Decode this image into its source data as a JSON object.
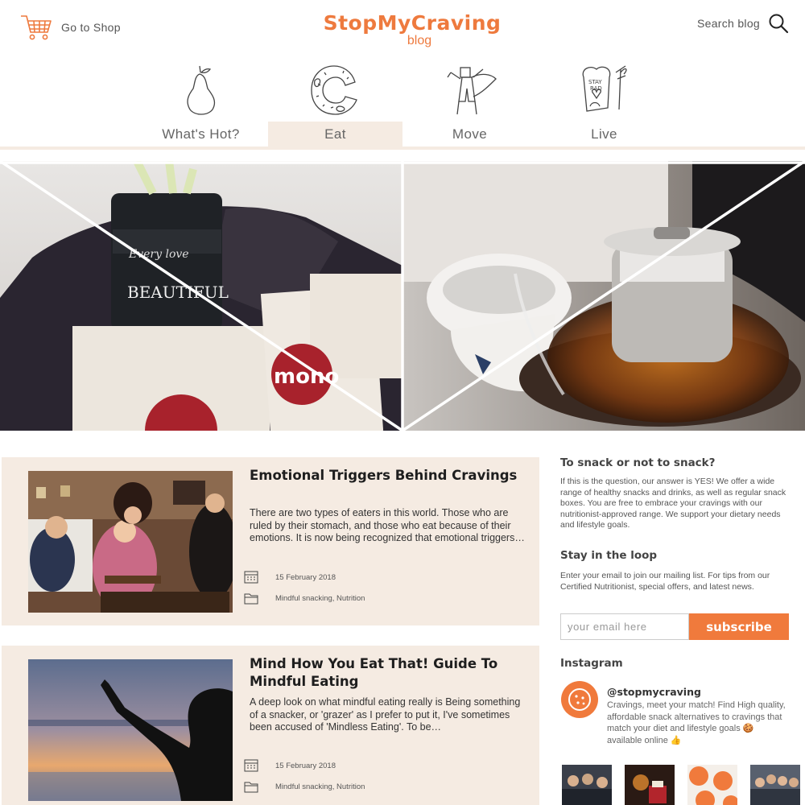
{
  "header": {
    "shop_label": "Go to Shop",
    "logo_text": "StopMyCraving",
    "logo_sub": "blog",
    "search_label": "Search blog"
  },
  "nav": {
    "items": [
      {
        "label": "What's Hot?",
        "icon": "pear-icon"
      },
      {
        "label": "Eat",
        "icon": "donut-icon"
      },
      {
        "label": "Move",
        "icon": "superhero-icon"
      },
      {
        "label": "Live",
        "icon": "toast-icon"
      }
    ],
    "active_index": 1
  },
  "hero": {
    "alt": "Mono superfood truffle boxes on a table with a glass teapot of tea"
  },
  "posts": [
    {
      "title": "Emotional Triggers Behind Cravings",
      "excerpt": "There are two types of eaters in this world. Those who are ruled by their stomach, and those who eat because of their emotions. It is now being recognized that emotional triggers…",
      "date": "15 February 2018",
      "categories": "Mindful snacking, Nutrition"
    },
    {
      "title": "Mind How You Eat That! Guide To Mindful Eating",
      "excerpt": "A deep look on what mindful eating really is   Being something of a snacker, or 'grazer' as I prefer to put it, I've sometimes been accused of 'Mindless Eating'. To be…",
      "date": "15 February 2018",
      "categories": "Mindful snacking, Nutrition"
    }
  ],
  "sidebar": {
    "snack_title": "To snack or not to snack?",
    "snack_text": "If this is the question, our answer is YES! We offer a wide range of healthy snacks and drinks, as well as regular snack boxes. You are free to embrace your cravings with our nutritionist-approved range. We support your dietary needs and lifestyle goals.",
    "loop_title": "Stay in the loop",
    "loop_text": "Enter your email to join our mailing list. For tips from our Certified Nutritionist, special offers, and latest news.",
    "email_placeholder": "your email here",
    "subscribe_label": "subscribe",
    "instagram_title": "Instagram",
    "insta_handle": "@stopmycraving",
    "insta_bio": "Cravings, meet your match! Find High quality, affordable snack alternatives to cravings that match your diet and lifestyle goals 🍪 available online 👍"
  },
  "colors": {
    "accent": "#f07a3c",
    "panel": "#f5ebe2"
  }
}
